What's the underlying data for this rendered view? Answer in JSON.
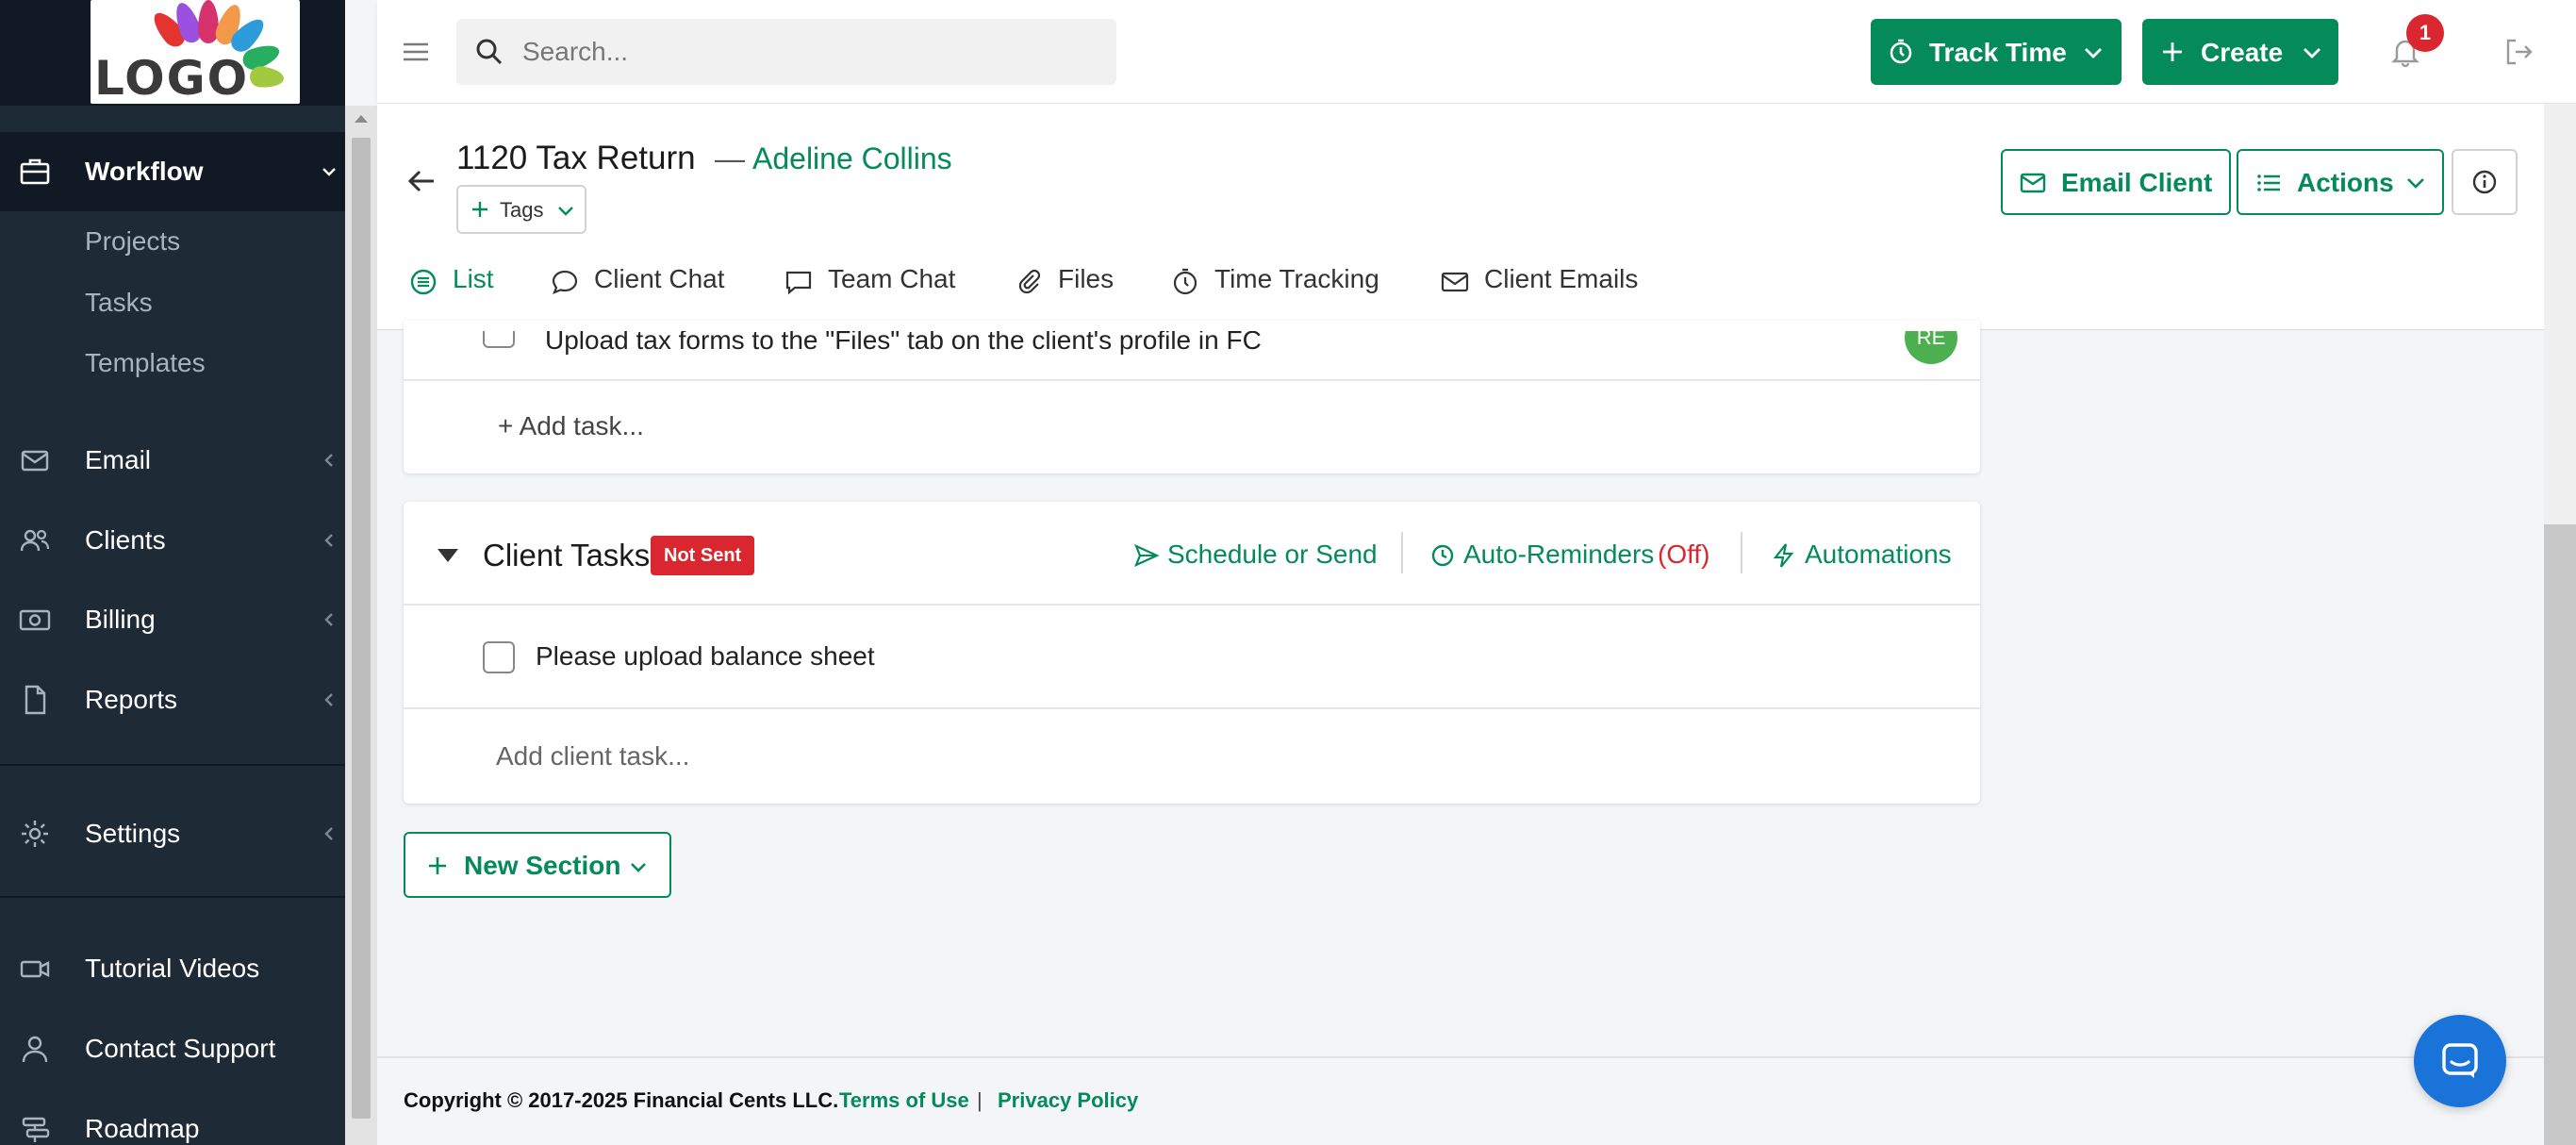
{
  "app": {
    "logo_text": "LOGO",
    "accent_color": "#058a5a",
    "sidebar_bg": "#1f2a37",
    "danger_color": "#d9262f"
  },
  "sidebar": {
    "workflow": {
      "label": "Workflow",
      "icon": "briefcase-icon"
    },
    "workflow_sub": [
      {
        "label": "Projects"
      },
      {
        "label": "Tasks"
      },
      {
        "label": "Templates"
      }
    ],
    "email": {
      "label": "Email",
      "icon": "envelope-icon"
    },
    "clients": {
      "label": "Clients",
      "icon": "users-icon"
    },
    "billing": {
      "label": "Billing",
      "icon": "money-icon"
    },
    "reports": {
      "label": "Reports",
      "icon": "document-icon"
    },
    "settings": {
      "label": "Settings",
      "icon": "gear-icon"
    },
    "tutorial": {
      "label": "Tutorial Videos",
      "icon": "video-icon"
    },
    "support": {
      "label": "Contact Support",
      "icon": "person-icon"
    },
    "roadmap": {
      "label": "Roadmap",
      "icon": "roadmap-icon"
    }
  },
  "topbar": {
    "search_placeholder": "Search...",
    "track_time_label": "Track Time",
    "create_label": "Create",
    "notification_count": "1"
  },
  "header": {
    "project_title": "1120 Tax Return",
    "title_separator": "—",
    "client_name": "Adeline Collins",
    "tags_label": "Tags",
    "email_client_label": "Email Client",
    "actions_label": "Actions"
  },
  "tabs": [
    {
      "label": "List",
      "icon": "list-icon",
      "active": true
    },
    {
      "label": "Client Chat",
      "icon": "chat-bubble-icon"
    },
    {
      "label": "Team Chat",
      "icon": "comment-icon"
    },
    {
      "label": "Files",
      "icon": "paperclip-icon"
    },
    {
      "label": "Time Tracking",
      "icon": "stopwatch-icon"
    },
    {
      "label": "Client Emails",
      "icon": "envelope-icon"
    }
  ],
  "team_tasks": {
    "partial_task": "Upload tax forms to the \"Files\" tab on the client's profile in FC",
    "assignee_initials": "RE",
    "add_task_label": "+ Add task..."
  },
  "client_tasks": {
    "title": "Client Tasks",
    "status": "Not Sent",
    "schedule_label": "Schedule or Send",
    "reminders_label": "Auto-Reminders",
    "reminders_state": "(Off)",
    "automations_label": "Automations",
    "tasks": [
      {
        "label": "Please upload balance sheet",
        "checked": false
      }
    ],
    "add_task_label": "Add client task..."
  },
  "new_section_label": "New Section",
  "footer": {
    "copyright": "Copyright © 2017-2025 Financial Cents LLC.",
    "terms_label": "Terms of Use",
    "separator": "|",
    "privacy_label": "Privacy Policy"
  }
}
